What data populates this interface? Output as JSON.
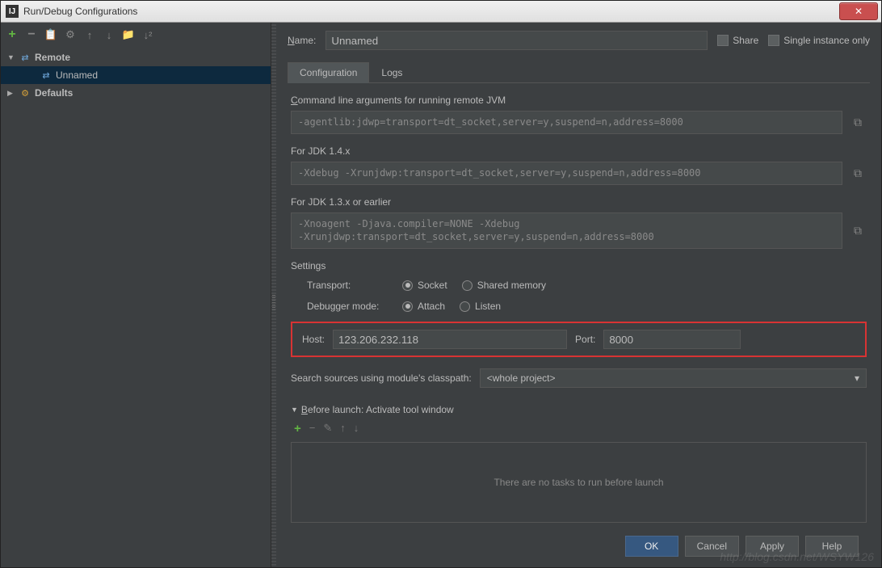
{
  "titlebar": {
    "title": "Run/Debug Configurations"
  },
  "tree": {
    "remote": "Remote",
    "unnamed": "Unnamed",
    "defaults": "Defaults"
  },
  "name": {
    "label": "Name:",
    "value": "Unnamed"
  },
  "share": "Share",
  "single_instance": "Single instance only",
  "tabs": {
    "config": "Configuration",
    "logs": "Logs"
  },
  "cmd": {
    "label": "Command line arguments for running remote JVM",
    "value": "-agentlib:jdwp=transport=dt_socket,server=y,suspend=n,address=8000"
  },
  "jdk14": {
    "label": "For JDK 1.4.x",
    "value": "-Xdebug -Xrunjdwp:transport=dt_socket,server=y,suspend=n,address=8000"
  },
  "jdk13": {
    "label": "For JDK 1.3.x or earlier",
    "value": "-Xnoagent -Djava.compiler=NONE -Xdebug\n-Xrunjdwp:transport=dt_socket,server=y,suspend=n,address=8000"
  },
  "settings": {
    "title": "Settings",
    "transport": "Transport:",
    "socket": "Socket",
    "shared": "Shared memory",
    "mode": "Debugger mode:",
    "attach": "Attach",
    "listen": "Listen",
    "host_label": "Host:",
    "host_value": "123.206.232.118",
    "port_label": "Port:",
    "port_value": "8000"
  },
  "search": {
    "label": "Search sources using module's classpath:",
    "value": "<whole project>"
  },
  "before": {
    "title": "Before launch: Activate tool window",
    "empty": "There are no tasks to run before launch"
  },
  "buttons": {
    "ok": "OK",
    "cancel": "Cancel",
    "apply": "Apply",
    "help": "Help"
  },
  "watermark": "http://blog.csdn.net/WSYW126"
}
